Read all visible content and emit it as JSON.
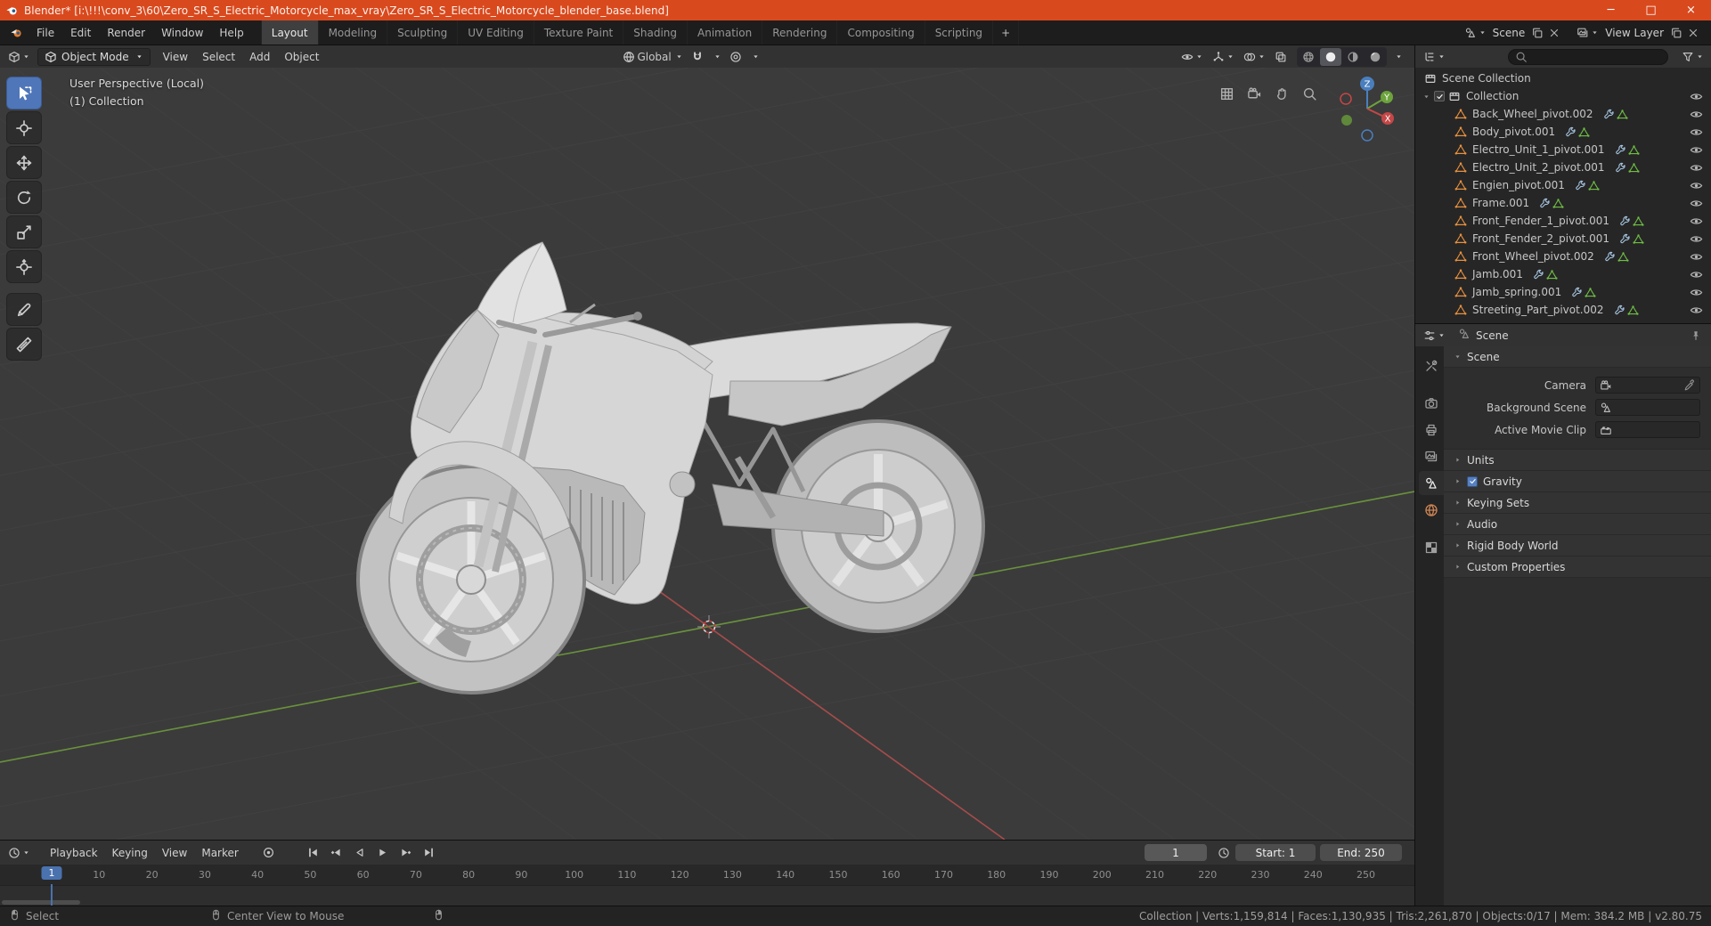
{
  "colors": {
    "titlebar_orange": "#D9491E",
    "accent_blue": "#4A72AE",
    "selection_blue": "#5680C2",
    "object_orange": "#E8903E",
    "mesh_green": "#6FBE44",
    "modifier_blue": "#A5C4E0",
    "axis_x_red": "#C54747",
    "axis_y_green": "#6CA33C",
    "axis_z_blue": "#4A7FBF",
    "grid_green_axis": "#6E9B3D",
    "grid_red_axis": "#B34D4D"
  },
  "titlebar": {
    "title": "Blender* [i:\\!!!\\conv_3\\60\\Zero_SR_S_Electric_Motorcycle_max_vray\\Zero_SR_S_Electric_Motorcycle_blender_base.blend]"
  },
  "topbar": {
    "menus": [
      "File",
      "Edit",
      "Render",
      "Window",
      "Help"
    ],
    "workspaces": [
      {
        "label": "Layout",
        "active": true
      },
      {
        "label": "Modeling"
      },
      {
        "label": "Sculpting"
      },
      {
        "label": "UV Editing"
      },
      {
        "label": "Texture Paint"
      },
      {
        "label": "Shading"
      },
      {
        "label": "Animation"
      },
      {
        "label": "Rendering"
      },
      {
        "label": "Compositing"
      },
      {
        "label": "Scripting"
      }
    ],
    "add_workspace": "+",
    "scene": "Scene",
    "view_layer": "View Layer"
  },
  "viewport": {
    "mode": "Object Mode",
    "menus": [
      "View",
      "Select",
      "Add",
      "Object"
    ],
    "orientation": "Global",
    "overlay_line1": "User Perspective (Local)",
    "overlay_line2": "(1) Collection",
    "gizmo": {
      "x": "X",
      "y": "Y",
      "z": "Z"
    }
  },
  "toolbar": [
    {
      "name": "select-box",
      "active": true
    },
    {
      "name": "cursor"
    },
    {
      "name": "move"
    },
    {
      "name": "rotate"
    },
    {
      "name": "scale"
    },
    {
      "name": "transform"
    },
    {
      "name": "annotate",
      "gap": true
    },
    {
      "name": "measure"
    }
  ],
  "outliner": {
    "scene_collection": "Scene Collection",
    "collection": "Collection",
    "objects": [
      "Back_Wheel_pivot.002",
      "Body_pivot.001",
      "Electro_Unit_1_pivot.001",
      "Electro_Unit_2_pivot.001",
      "Engien_pivot.001",
      "Frame.001",
      "Front_Fender_1_pivot.001",
      "Front_Fender_2_pivot.001",
      "Front_Wheel_pivot.002",
      "Jamb.001",
      "Jamb_spring.001",
      "Streeting_Part_pivot.002"
    ]
  },
  "properties": {
    "breadcrumb": "Scene",
    "tabs": [
      "tool",
      "render",
      "output",
      "view-layer",
      "scene",
      "world",
      "texture"
    ],
    "active_tab": "scene",
    "scene_fields": [
      {
        "label": "Camera",
        "icon": "camera-data",
        "eyedropper": true
      },
      {
        "label": "Background Scene",
        "icon": "scene-data"
      },
      {
        "label": "Active Movie Clip",
        "icon": "clip"
      }
    ],
    "panels": [
      {
        "label": "Scene",
        "expanded": true
      },
      {
        "label": "Units"
      },
      {
        "label": "Gravity",
        "checkbox": true,
        "checked": true
      },
      {
        "label": "Keying Sets"
      },
      {
        "label": "Audio"
      },
      {
        "label": "Rigid Body World"
      },
      {
        "label": "Custom Properties"
      }
    ]
  },
  "timeline": {
    "menus": [
      "Playback",
      "Keying",
      "View",
      "Marker"
    ],
    "current_frame": "1",
    "start_field": "Start: 1",
    "end_field": "End: 250",
    "playhead_frame": 1,
    "ticks": [
      1,
      10,
      20,
      30,
      40,
      50,
      60,
      70,
      80,
      90,
      100,
      110,
      120,
      130,
      140,
      150,
      160,
      170,
      180,
      190,
      200,
      210,
      220,
      230,
      240,
      250
    ]
  },
  "statusbar": {
    "left": [
      "Select",
      "Center View to Mouse"
    ],
    "stats": "Collection | Verts:1,159,814 | Faces:1,130,935 | Tris:2,261,870 | Objects:0/17 | Mem: 384.2 MB | v2.80.75"
  }
}
